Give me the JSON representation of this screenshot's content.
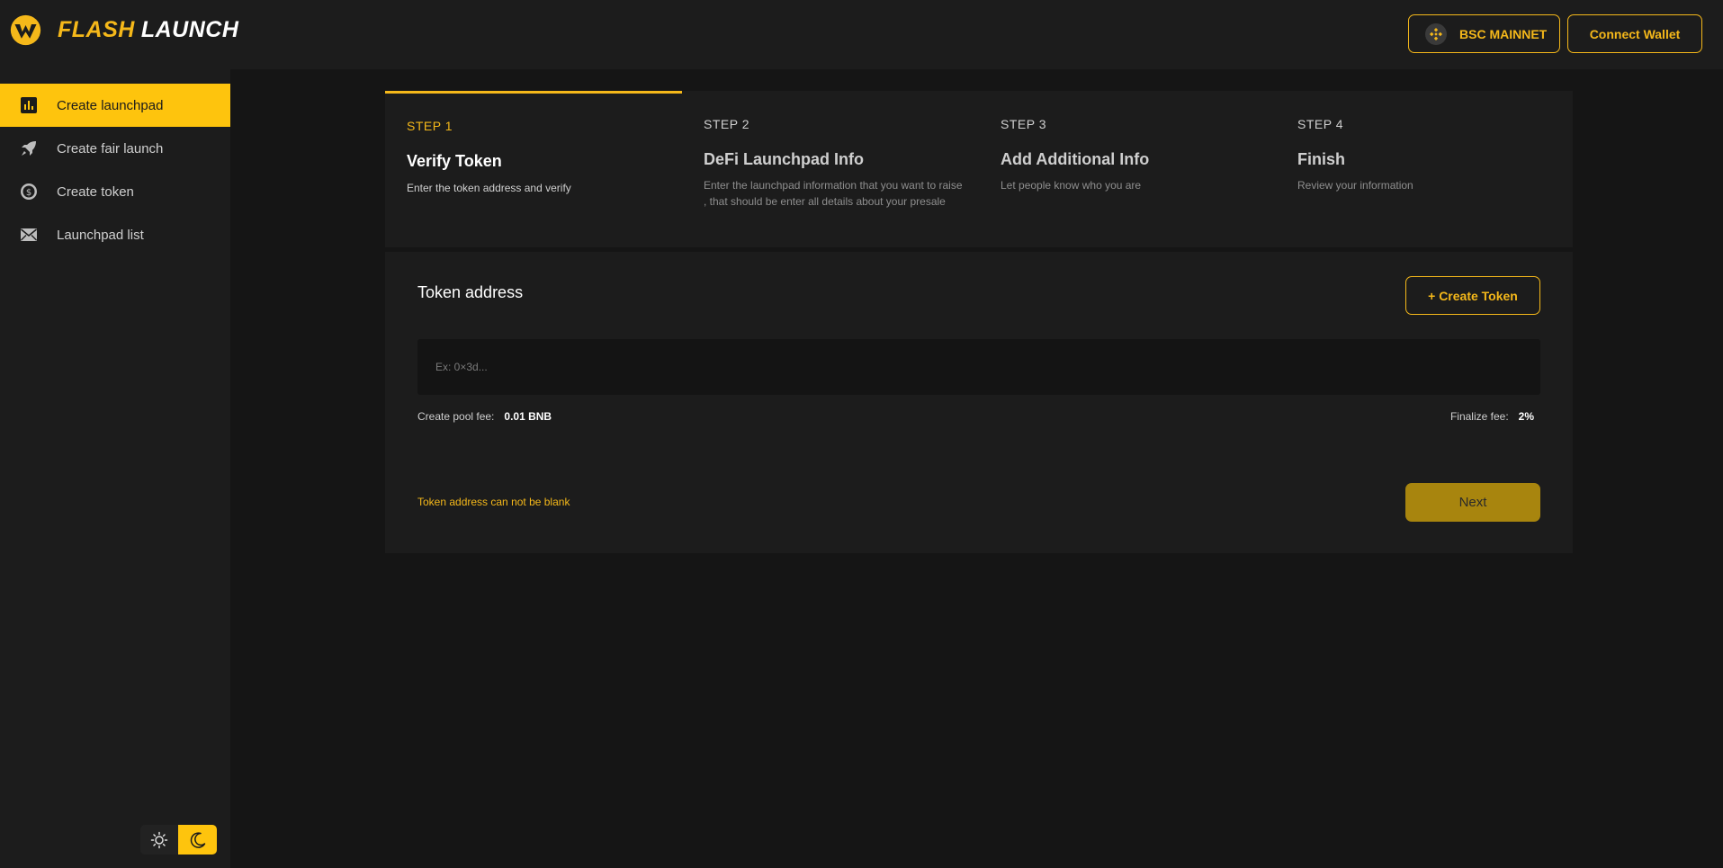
{
  "header": {
    "brand_primary": "FLASH",
    "brand_secondary": "LAUNCH",
    "network_label": "BSC MAINNET",
    "network_icon": "bnb-icon",
    "connect_label": "Connect Wallet"
  },
  "sidebar": {
    "items": [
      {
        "label": "Create launchpad",
        "icon": "bar-chart-icon",
        "active": true
      },
      {
        "label": "Create fair launch",
        "icon": "rocket-icon",
        "active": false
      },
      {
        "label": "Create token",
        "icon": "dollar-coin-icon",
        "active": false
      },
      {
        "label": "Launchpad list",
        "icon": "envelope-icon",
        "active": false
      }
    ],
    "theme": {
      "light_icon": "sun-icon",
      "dark_icon": "moon-icon",
      "selected": "dark"
    }
  },
  "steps": [
    {
      "number": "STEP 1",
      "title": "Verify Token",
      "description": "Enter the token address and verify",
      "active": true
    },
    {
      "number": "STEP 2",
      "title": "DeFi Launchpad Info",
      "description": "Enter the launchpad information that you want to raise , that should be enter all details about your presale",
      "active": false
    },
    {
      "number": "STEP 3",
      "title": "Add Additional Info",
      "description": "Let people know who you are",
      "active": false
    },
    {
      "number": "STEP 4",
      "title": "Finish",
      "description": "Review your information",
      "active": false
    }
  ],
  "form": {
    "title": "Token address",
    "create_token_label": "+ Create Token",
    "input_placeholder": "Ex: 0×3d...",
    "input_value": "",
    "pool_fee_label": "Create pool fee:",
    "pool_fee_value": "0.01 BNB",
    "finalize_fee_label": "Finalize fee:",
    "finalize_fee_value": "2%",
    "error": "Token address can not be blank",
    "next_label": "Next"
  },
  "colors": {
    "accent": "#fec40d",
    "accent_text": "#f5b81a",
    "background": "#151515",
    "panel": "#1c1c1c",
    "next_button": "#a8850e"
  }
}
